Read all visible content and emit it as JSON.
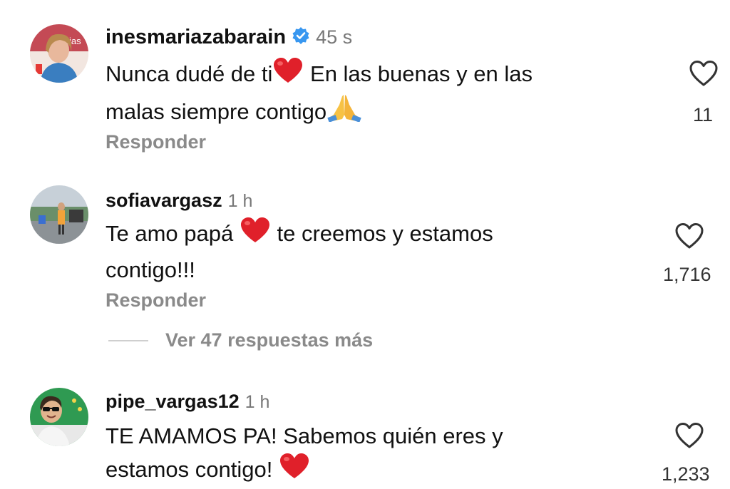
{
  "comments": [
    {
      "username": "inesmariazabarain",
      "verified": true,
      "time": "45 s",
      "line1": "Nunca dudé de ti",
      "line1b": " En las buenas y en las",
      "line2": "malas siempre contigo",
      "reply": "Responder",
      "likes": "11",
      "avatar": "woman-portrait"
    },
    {
      "username": "sofiavargasz",
      "verified": false,
      "time": "1 h",
      "line1a": "Te amo papá ",
      "line1b": " te creemos y estamos",
      "line2": "contigo!!!",
      "reply": "Responder",
      "likes": "1,716",
      "avatar": "outdoor-photo"
    },
    {
      "username": "pipe_vargas12",
      "verified": false,
      "time": "1 h",
      "line1": "TE AMAMOS PA! Sabemos quién eres y",
      "line2": "estamos contigo! ",
      "likes": "1,233",
      "avatar": "man-sunglasses"
    }
  ],
  "more_replies": "Ver 47 respuestas más",
  "colors": {
    "verified": "#3897f0",
    "heart_emoji": "#e0202a",
    "muted": "#8a8a8a"
  },
  "icons": [
    "heart-outline-icon",
    "red-heart-emoji",
    "praying-hands-emoji",
    "verified-badge-icon"
  ]
}
